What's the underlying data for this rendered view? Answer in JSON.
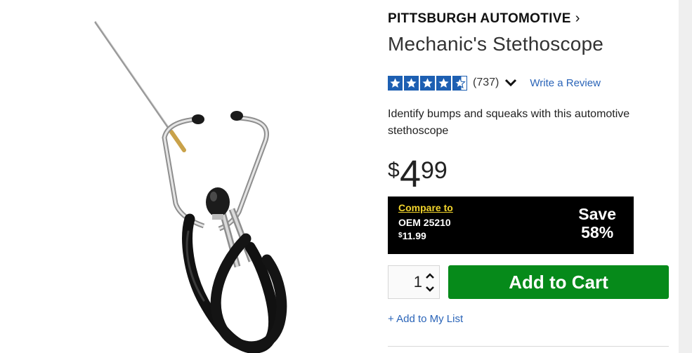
{
  "product": {
    "brand": "PITTSBURGH AUTOMOTIVE",
    "title": "Mechanic's Stethoscope",
    "rating": {
      "stars": 4.5,
      "max": 5,
      "count": "(737)"
    },
    "write_review": "Write a Review",
    "description": "Identify bumps and squeaks with this automotive stethoscope",
    "price": {
      "dollar_sign": "$",
      "whole": "4",
      "cents": "99"
    },
    "compare": {
      "label": "Compare to",
      "oem": "OEM 25210",
      "currency": "$",
      "price": "11.99",
      "save_label": "Save",
      "save_percent": "58%"
    },
    "quantity": "1",
    "add_to_cart": "Add to Cart",
    "add_to_list": "+ Add to My List"
  },
  "colors": {
    "brand_blue": "#1d5fb2",
    "cart_green": "#068a1a",
    "compare_bg": "#000000",
    "compare_link": "#f2d42c",
    "link_blue": "#2a64b8"
  },
  "icons": [
    "chevron-right-icon",
    "star-icon",
    "chevron-down-icon",
    "caret-up-icon",
    "caret-down-icon"
  ]
}
